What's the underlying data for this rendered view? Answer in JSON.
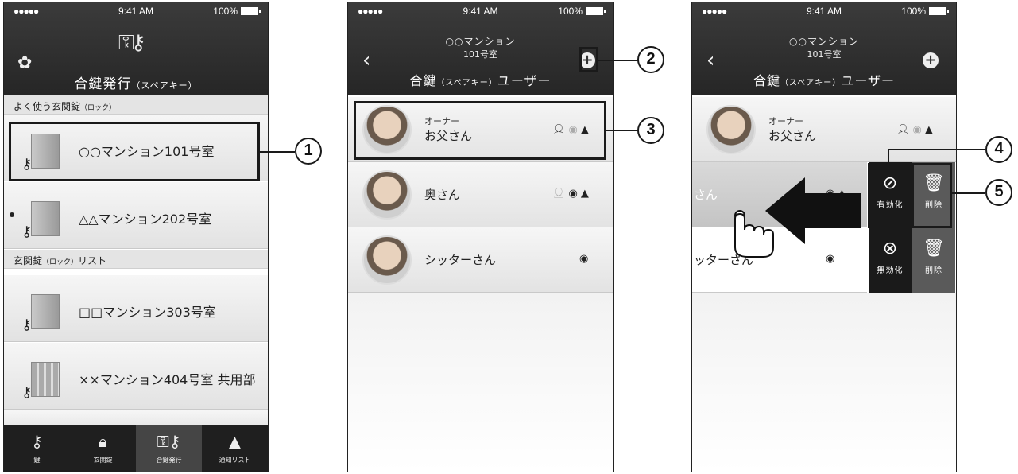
{
  "status": {
    "signal": "●●●●● ",
    "time": "9:41 AM",
    "battery": "100%"
  },
  "panel1": {
    "title": "合鍵発行",
    "title_suffix": "（スペアキー）",
    "section_frequent": "よく使う玄関錠",
    "section_frequent_suffix": "（ロック）",
    "section_list": "玄関錠",
    "section_list_mid": "（ロック）",
    "section_list_suffix": "リスト",
    "locks": [
      {
        "name": "○○マンション101号室"
      },
      {
        "name": "△△マンション202号室"
      },
      {
        "name": "□□マンション303号室"
      },
      {
        "name": "××マンション404号室 共用部"
      }
    ],
    "tabs": [
      {
        "label": "鍵",
        "icon": "key-icon"
      },
      {
        "label": "玄関錠",
        "icon": "padlock-icon"
      },
      {
        "label": "合鍵発行",
        "icon": "keys-icon"
      },
      {
        "label": "通知リスト",
        "icon": "bell-icon"
      }
    ]
  },
  "panel2": {
    "building": "○○マンション",
    "room": "101号室",
    "title_a": "合鍵",
    "title_b": "（スペアキー）",
    "title_c": "ユーザー",
    "users": [
      {
        "role": "オーナー",
        "name": "お父さん"
      },
      {
        "role": "",
        "name": "奥さん"
      },
      {
        "role": "",
        "name": "シッターさん"
      }
    ]
  },
  "panel3": {
    "building": "○○マンション",
    "room": "101号室",
    "title_a": "合鍵",
    "title_b": "（スペアキー）",
    "title_c": "ユーザー",
    "owner_role": "オーナー",
    "owner_name": "お父さん",
    "partial_name": "さん",
    "partial_name2": "ッターさん",
    "enable_label": "有効化",
    "disable_label": "無効化",
    "delete_label": "削除"
  },
  "callouts": [
    "1",
    "2",
    "3",
    "4",
    "5"
  ]
}
